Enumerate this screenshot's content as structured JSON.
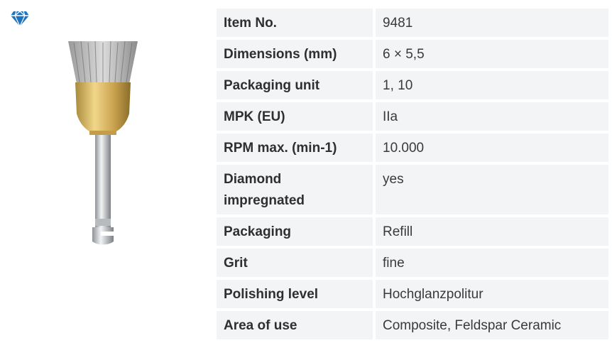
{
  "brand": {
    "icon": "diamond-icon",
    "accent_color": "#1e73be"
  },
  "product": {
    "image": "polishing-brush-icon"
  },
  "specs": [
    {
      "label": "Item No.",
      "value": "9481"
    },
    {
      "label": "Dimensions (mm)",
      "value": "6 × 5,5"
    },
    {
      "label": "Packaging unit",
      "value": "1, 10"
    },
    {
      "label": "MPK (EU)",
      "value": "IIa"
    },
    {
      "label": "RPM max. (min-1)",
      "value": "10.000"
    },
    {
      "label": "Diamond impregnated",
      "value": "yes"
    },
    {
      "label": "Packaging",
      "value": "Refill"
    },
    {
      "label": "Grit",
      "value": "fine"
    },
    {
      "label": "Polishing level",
      "value": "Hochglanzpolitur"
    },
    {
      "label": "Area of use",
      "value": "Composite, Feldspar Ceramic"
    }
  ]
}
